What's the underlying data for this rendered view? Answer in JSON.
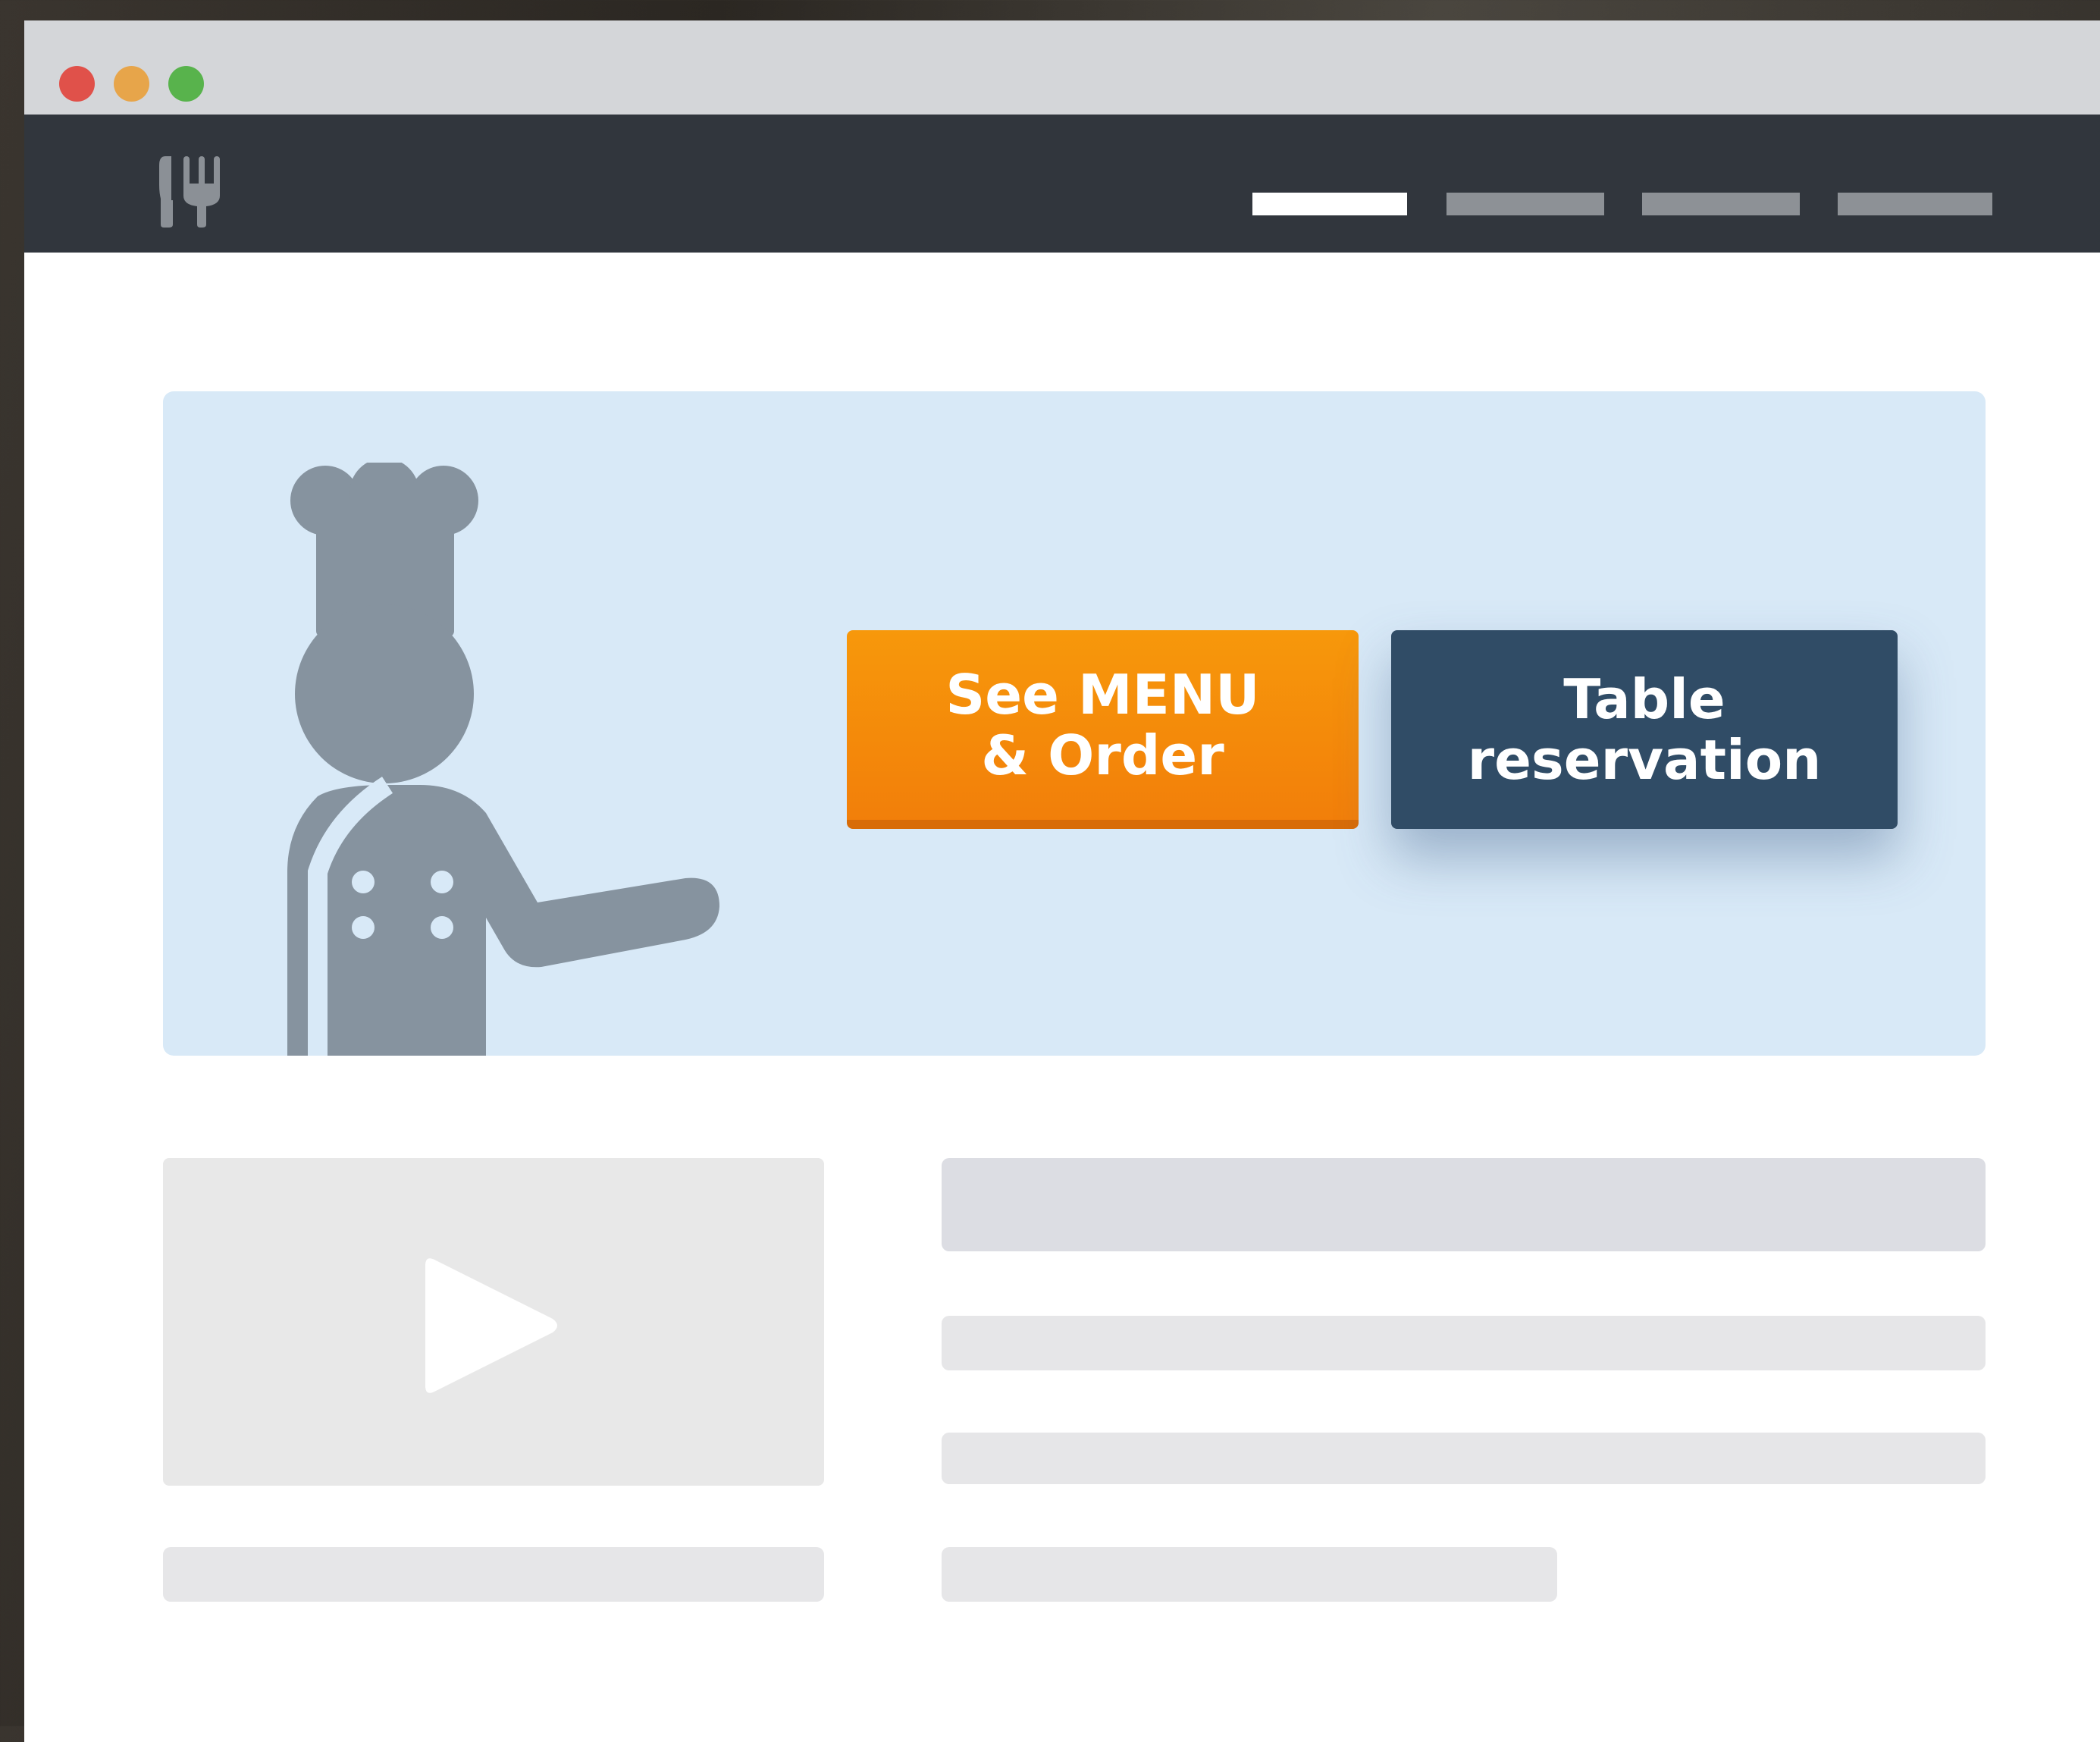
{
  "window": {
    "controls": [
      "close",
      "minimize",
      "maximize"
    ]
  },
  "navbar": {
    "logo_icon": "fork-knife-icon",
    "links": [
      {
        "state": "active"
      },
      {
        "state": "inactive"
      },
      {
        "state": "inactive"
      },
      {
        "state": "inactive"
      }
    ]
  },
  "hero": {
    "illustration": "chef-icon",
    "menu_button": {
      "line1": "See MENU",
      "line2": "& Order"
    },
    "reservation_button": {
      "line1": "Table",
      "line2": "reservation"
    }
  },
  "content": {
    "media_icon": "play-icon"
  },
  "colors": {
    "navbar": "#31363d",
    "hero_background": "#d8e9f7",
    "orange_button": "#f58a0a",
    "navy_button": "#304c66",
    "chef": "#86939f",
    "placeholder": "#e6e6e8"
  }
}
